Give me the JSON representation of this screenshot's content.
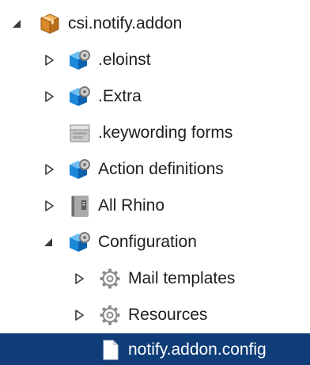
{
  "tree": {
    "items": [
      {
        "label": "csi.notify.addon",
        "icon": "package-icon",
        "expander": "expanded"
      },
      {
        "label": ".eloinst",
        "icon": "gear-cube-icon",
        "expander": "collapsed"
      },
      {
        "label": ".Extra",
        "icon": "gear-cube-icon",
        "expander": "collapsed"
      },
      {
        "label": ".keywording forms",
        "icon": "form-folder-icon",
        "expander": "none"
      },
      {
        "label": "Action definitions",
        "icon": "gear-cube-icon",
        "expander": "collapsed"
      },
      {
        "label": "All Rhino",
        "icon": "binder-icon",
        "expander": "collapsed"
      },
      {
        "label": "Configuration",
        "icon": "gear-cube-icon",
        "expander": "expanded"
      },
      {
        "label": "Mail templates",
        "icon": "gear-icon",
        "expander": "collapsed"
      },
      {
        "label": "Resources",
        "icon": "gear-icon",
        "expander": "collapsed"
      },
      {
        "label": "notify.addon.config",
        "icon": "file-icon",
        "expander": "none",
        "selected": true
      }
    ]
  },
  "colors": {
    "selection": "#0f3d78",
    "package": "#d9892b",
    "gear_cube": "#1b88d8"
  }
}
